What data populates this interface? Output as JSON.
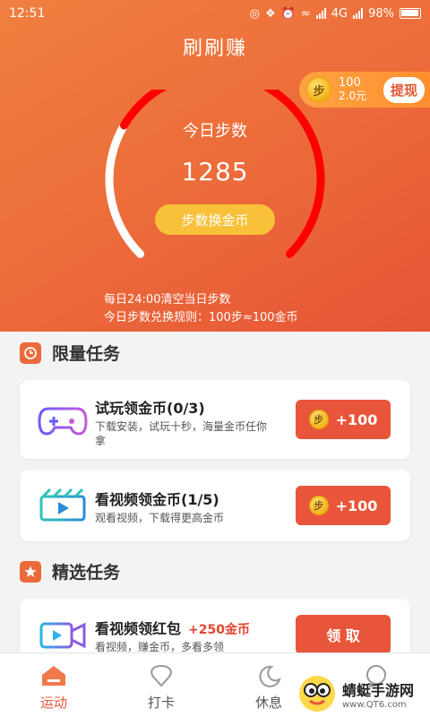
{
  "status": {
    "time": "12:51",
    "network": "4G",
    "battery": "98%"
  },
  "header": {
    "title": "刷刷赚",
    "wallet": {
      "coins": "100",
      "cash": "2.0元",
      "coin_glyph": "步",
      "withdraw_label": "提现"
    },
    "today_label": "今日步数",
    "steps": "1285",
    "step_progress": 0.72,
    "exchange_label": "步数换金币",
    "rules": [
      "每日24:00清空当日步数",
      "今日步数兑换规则：100步≈100金币"
    ]
  },
  "limited": {
    "title": "限量任务",
    "tasks": [
      {
        "title": "试玩领金币(0/3)",
        "desc_line1": "下载安装，试玩十秒，海量金币任你",
        "desc_line2": "拿",
        "coin_glyph": "步",
        "button": "+100",
        "icon": "gamepad-icon"
      },
      {
        "title": "看视频领金币(1/5)",
        "desc": "观看视频，下载得更高金币",
        "coin_glyph": "步",
        "button": "+100",
        "icon": "film-icon"
      }
    ]
  },
  "featured": {
    "title": "精选任务",
    "tasks": [
      {
        "title": "看视频领红包",
        "bonus": "+250金币",
        "desc": "看视频，赚金币，多看多领",
        "button": "领 取",
        "icon": "video-camera-icon"
      }
    ]
  },
  "tabs": [
    {
      "label": "运动",
      "icon": "home-icon",
      "active": true
    },
    {
      "label": "打卡",
      "icon": "map-pin-icon",
      "active": false
    },
    {
      "label": "休息",
      "icon": "moon-icon",
      "active": false
    },
    {
      "label": "",
      "icon": "chat-icon",
      "active": false
    }
  ],
  "watermark": {
    "title": "蜻蜓手游网",
    "url": "www.QT6.com"
  },
  "colors": {
    "accent": "#e8553a",
    "gauge_red": "#ff0000",
    "button_yellow": "#f9c13a"
  }
}
